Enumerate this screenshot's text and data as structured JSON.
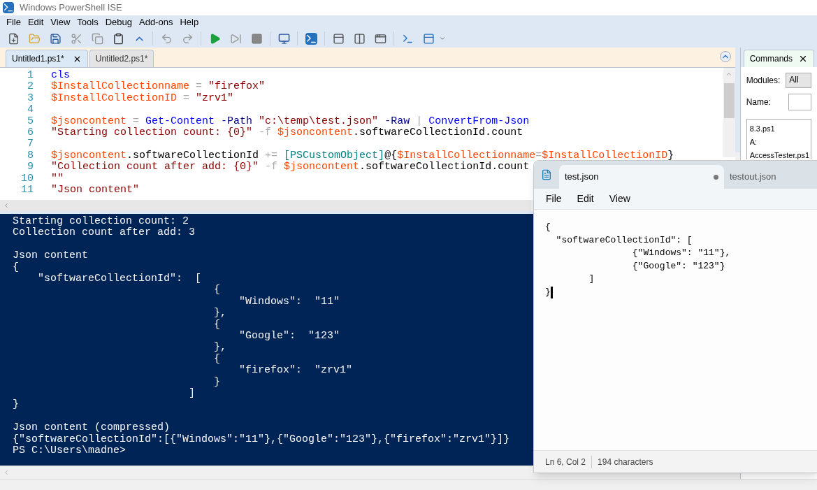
{
  "window": {
    "title": "Windows PowerShell ISE"
  },
  "menu": [
    "File",
    "Edit",
    "View",
    "Tools",
    "Debug",
    "Add-ons",
    "Help"
  ],
  "script_tabs": [
    {
      "label": "Untitled1.ps1*",
      "selected": true
    },
    {
      "label": "Untitled2.ps1*",
      "selected": false
    }
  ],
  "editor": {
    "lines": [
      {
        "number": "1",
        "tokens": [
          {
            "kind": "keyword",
            "text": "cls"
          }
        ]
      },
      {
        "number": "2",
        "tokens": [
          {
            "kind": "variable",
            "text": "$InstallCollectionname"
          },
          {
            "kind": "operator",
            "text": " = "
          },
          {
            "kind": "string",
            "text": "\"firefox\""
          }
        ]
      },
      {
        "number": "3",
        "tokens": [
          {
            "kind": "variable",
            "text": "$InstallCollectionID"
          },
          {
            "kind": "operator",
            "text": " = "
          },
          {
            "kind": "string",
            "text": "\"zrv1\""
          }
        ]
      },
      {
        "number": "4"
      },
      {
        "number": "5",
        "tokens": [
          {
            "kind": "variable",
            "text": "$jsoncontent"
          },
          {
            "kind": "operator",
            "text": " = "
          },
          {
            "kind": "keyword",
            "text": "Get-Content"
          },
          {
            "kind": "parameter",
            "text": " -Path "
          },
          {
            "kind": "string",
            "text": "\"c:\\temp\\test.json\""
          },
          {
            "kind": "parameter",
            "text": " -Raw "
          },
          {
            "kind": "operator",
            "text": "| "
          },
          {
            "kind": "keyword",
            "text": "ConvertFrom-Json"
          }
        ]
      },
      {
        "number": "6",
        "tokens": [
          {
            "kind": "string",
            "text": "\"Starting collection count: {0}\""
          },
          {
            "kind": "operator",
            "text": " -f "
          },
          {
            "kind": "variable",
            "text": "$jsoncontent"
          },
          {
            "kind": "plain",
            "text": ".softwareCollectionId.count"
          }
        ]
      },
      {
        "number": "7"
      },
      {
        "number": "8",
        "tokens": [
          {
            "kind": "variable",
            "text": "$jsoncontent"
          },
          {
            "kind": "plain",
            "text": ".softwareCollectionId "
          },
          {
            "kind": "operator",
            "text": "+= "
          },
          {
            "kind": "type",
            "text": "[PSCustomObject]"
          },
          {
            "kind": "plain",
            "text": "@{"
          },
          {
            "kind": "variable",
            "text": "$InstallCollectionname"
          },
          {
            "kind": "operator",
            "text": "="
          },
          {
            "kind": "variable",
            "text": "$InstallCollectionID"
          },
          {
            "kind": "plain",
            "text": "}"
          }
        ]
      },
      {
        "number": "9",
        "tokens": [
          {
            "kind": "string",
            "text": "\"Collection count after add: {0}\""
          },
          {
            "kind": "operator",
            "text": " -f "
          },
          {
            "kind": "variable",
            "text": "$jsoncontent"
          },
          {
            "kind": "plain",
            "text": ".softwareCollectionId.count"
          }
        ]
      },
      {
        "number": "10",
        "tokens": [
          {
            "kind": "string",
            "text": "\"\""
          }
        ]
      },
      {
        "number": "11",
        "tokens": [
          {
            "kind": "string",
            "text": "\"Json content\""
          }
        ]
      }
    ]
  },
  "console": {
    "blocks": [
      [
        "Starting collection count: 2",
        "Collection count after add: 3"
      ],
      [
        "Json content",
        "{",
        "    \"softwareCollectionId\":  [",
        "                                {",
        "                                    \"Windows\":  \"11\"",
        "                                },",
        "                                {",
        "                                    \"Google\":  \"123\"",
        "                                },",
        "                                {",
        "                                    \"firefox\":  \"zrv1\"",
        "                                }",
        "                            ]",
        "}"
      ],
      [
        "Json content (compressed)",
        "{\"softwareCollectionId\":[{\"Windows\":\"11\"},{\"Google\":\"123\"},{\"firefox\":\"zrv1\"}]}",
        "PS C:\\Users\\madne>"
      ]
    ]
  },
  "commands": {
    "tab": "Commands",
    "modules_label": "Modules:",
    "modules_value": "All",
    "name_label": "Name:",
    "items": [
      "8.3.ps1",
      "A:",
      "AccessTester.ps1"
    ]
  },
  "notepad": {
    "tabs": [
      {
        "label": "test.json",
        "selected": true,
        "unsaved": true
      },
      {
        "label": "testout.json",
        "selected": false,
        "unsaved": false
      }
    ],
    "menu": [
      "File",
      "Edit",
      "View"
    ],
    "lines": [
      "{",
      "  \"softwareCollectionId\": [",
      "                {\"Windows\": \"11\"},",
      "                {\"Google\": \"123\"}",
      "        ]",
      "}"
    ],
    "status": {
      "position": "Ln 6, Col 2",
      "characters": "194 characters"
    }
  }
}
